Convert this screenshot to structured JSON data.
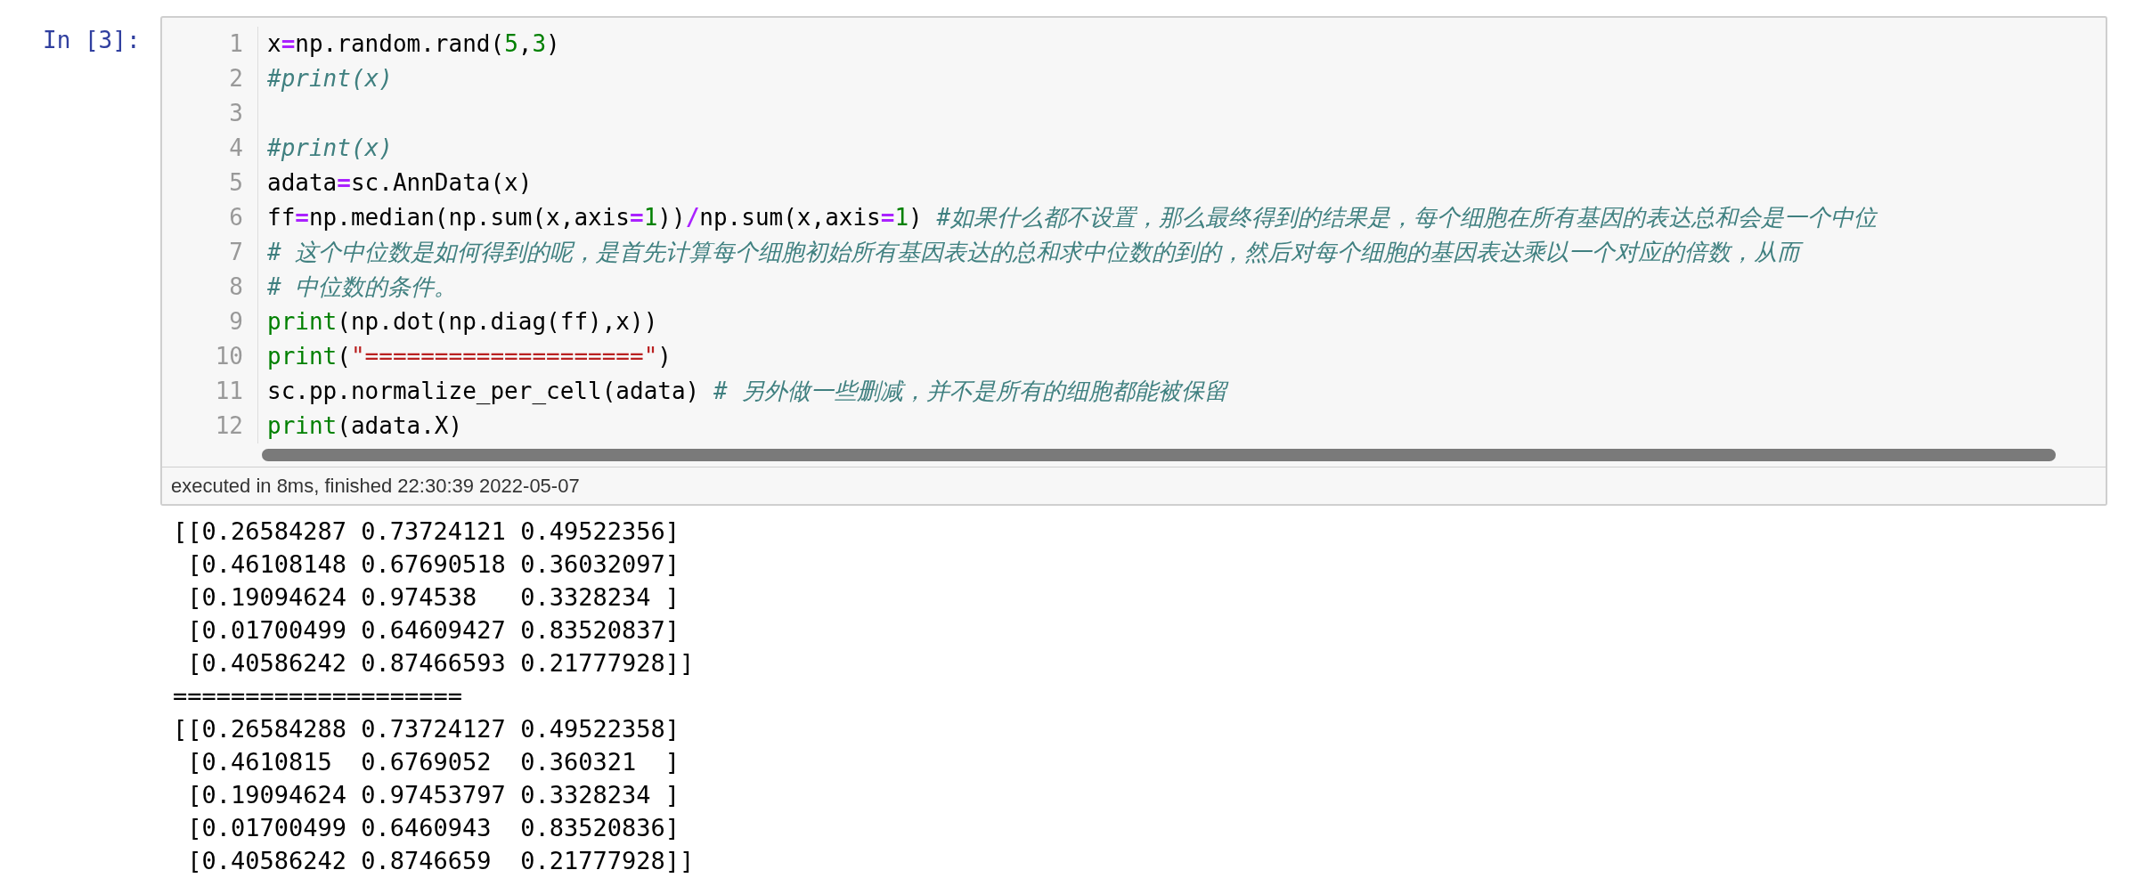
{
  "cell": {
    "prompt": "In [3]:",
    "lines": [
      {
        "number": "1",
        "tokens": [
          {
            "kind": "plain",
            "text": "x"
          },
          {
            "kind": "op",
            "text": "="
          },
          {
            "kind": "plain",
            "text": "np.random.rand("
          },
          {
            "kind": "num",
            "text": "5"
          },
          {
            "kind": "plain",
            "text": ","
          },
          {
            "kind": "num",
            "text": "3"
          },
          {
            "kind": "plain",
            "text": ")"
          }
        ]
      },
      {
        "number": "2",
        "tokens": [
          {
            "kind": "comment",
            "text": "#print(x)"
          }
        ]
      },
      {
        "number": "3"
      },
      {
        "number": "4",
        "tokens": [
          {
            "kind": "comment",
            "text": "#print(x)"
          }
        ]
      },
      {
        "number": "5",
        "tokens": [
          {
            "kind": "plain",
            "text": "adata"
          },
          {
            "kind": "op",
            "text": "="
          },
          {
            "kind": "plain",
            "text": "sc.AnnData(x)"
          }
        ]
      },
      {
        "number": "6",
        "tokens": [
          {
            "kind": "plain",
            "text": "ff"
          },
          {
            "kind": "op",
            "text": "="
          },
          {
            "kind": "plain",
            "text": "np.median(np.sum(x,axis"
          },
          {
            "kind": "op",
            "text": "="
          },
          {
            "kind": "num",
            "text": "1"
          },
          {
            "kind": "plain",
            "text": "))"
          },
          {
            "kind": "op",
            "text": "/"
          },
          {
            "kind": "plain",
            "text": "np.sum(x,axis"
          },
          {
            "kind": "op",
            "text": "="
          },
          {
            "kind": "num",
            "text": "1"
          },
          {
            "kind": "plain",
            "text": ") "
          },
          {
            "kind": "comment",
            "text": "#如果什么都不设置，那么最终得到的结果是，每个细胞在所有基因的表达总和会是一个中位"
          }
        ]
      },
      {
        "number": "7",
        "tokens": [
          {
            "kind": "comment",
            "text": "# 这个中位数是如何得到的呢，是首先计算每个细胞初始所有基因表达的总和求中位数的到的，然后对每个细胞的基因表达乘以一个对应的倍数，从而"
          }
        ]
      },
      {
        "number": "8",
        "tokens": [
          {
            "kind": "comment",
            "text": "# 中位数的条件。"
          }
        ]
      },
      {
        "number": "9",
        "tokens": [
          {
            "kind": "builtin",
            "text": "print"
          },
          {
            "kind": "plain",
            "text": "(np.dot(np.diag(ff),x))"
          }
        ]
      },
      {
        "number": "10",
        "tokens": [
          {
            "kind": "builtin",
            "text": "print"
          },
          {
            "kind": "plain",
            "text": "("
          },
          {
            "kind": "string",
            "text": "\"====================\""
          },
          {
            "kind": "plain",
            "text": ")"
          }
        ]
      },
      {
        "number": "11",
        "tokens": [
          {
            "kind": "plain",
            "text": "sc.pp.normalize_per_cell(adata) "
          },
          {
            "kind": "comment",
            "text": "# 另外做一些删减，并不是所有的细胞都能被保留"
          }
        ]
      },
      {
        "number": "12",
        "tokens": [
          {
            "kind": "builtin",
            "text": "print"
          },
          {
            "kind": "plain",
            "text": "(adata.X)"
          }
        ]
      }
    ],
    "status": "executed in 8ms, finished 22:30:39 2022-05-07"
  },
  "output": {
    "lines": [
      "[[0.26584287 0.73724121 0.49522356]",
      " [0.46108148 0.67690518 0.36032097]",
      " [0.19094624 0.974538   0.3328234 ]",
      " [0.01700499 0.64609427 0.83520837]",
      " [0.40586242 0.87466593 0.21777928]]",
      "====================",
      "[[0.26584288 0.73724127 0.49522358]",
      " [0.4610815  0.6769052  0.360321  ]",
      " [0.19094624 0.97453797 0.3328234 ]",
      " [0.01700499 0.6460943  0.83520836]",
      " [0.40586242 0.8746659  0.21777928]]"
    ]
  }
}
